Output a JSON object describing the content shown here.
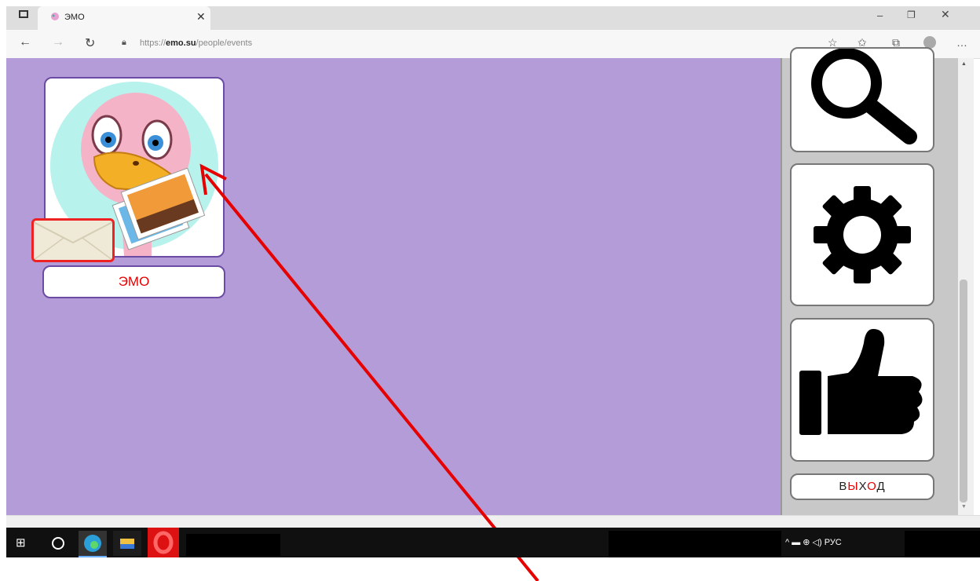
{
  "browser": {
    "tab_title": "ЭМО",
    "tab_close": "✕",
    "url_prefix": "https://",
    "url_host": "emo.su",
    "url_path": "/people/events",
    "window_min": "–",
    "window_restore": "❐",
    "window_close": "✕",
    "icons": [
      "tab-actions-icon",
      "back-icon",
      "forward-icon",
      "refresh-icon",
      "lock-icon",
      "read-aloud-icon",
      "favorites-icon",
      "collections-icon",
      "profile-icon",
      "more-icon"
    ]
  },
  "page": {
    "background": "#b39cd8",
    "friend_name_parts": [
      "ЭМ",
      "О"
    ],
    "logout_parts": [
      "В",
      "Ы",
      "Х",
      "О",
      "Д"
    ],
    "accent_red": "#e60000",
    "border_purple": "#6b4ba3"
  },
  "sidebar": {
    "buttons": [
      "search-icon",
      "gear-icon",
      "thumbs-up-icon"
    ]
  },
  "taskbar": {
    "tray_label": "^ ▬ ⊕ ◁) РУС"
  }
}
